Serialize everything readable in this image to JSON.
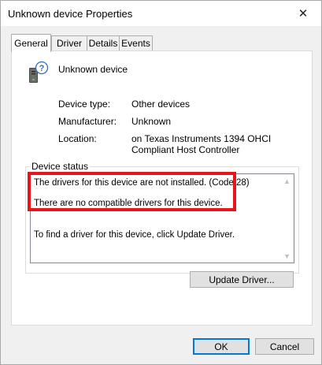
{
  "window": {
    "title": "Unknown device Properties",
    "close_glyph": "✕"
  },
  "tabs": [
    {
      "label": "General",
      "active": true
    },
    {
      "label": "Driver",
      "active": false
    },
    {
      "label": "Details",
      "active": false
    },
    {
      "label": "Events",
      "active": false
    }
  ],
  "device": {
    "icon": "unknown-device-icon",
    "name": "Unknown device",
    "properties": [
      {
        "label": "Device type:",
        "value": "Other devices"
      },
      {
        "label": "Manufacturer:",
        "value": "Unknown"
      },
      {
        "label": "Location:",
        "value": "on Texas Instruments 1394 OHCI Compliant Host Controller"
      }
    ]
  },
  "status": {
    "group_label": "Device status",
    "lines": [
      "The drivers for this device are not installed. (Code 28)",
      "There are no compatible drivers for this device.",
      "To find a driver for this device, click Update Driver."
    ],
    "highlight_color": "#e8141c"
  },
  "buttons": {
    "update_driver": "Update Driver...",
    "ok": "OK",
    "cancel": "Cancel"
  },
  "colors": {
    "accent": "#0078d7"
  }
}
